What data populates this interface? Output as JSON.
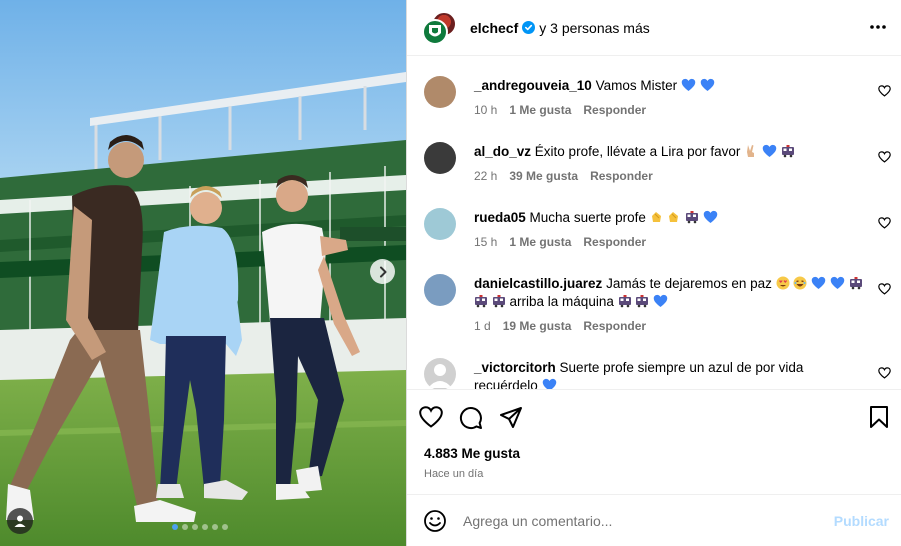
{
  "header": {
    "username": "elchecf",
    "collaborators_text": "y 3 personas más"
  },
  "comments": [
    {
      "username": "_andregouveia_10",
      "text": "Vamos Mister",
      "emojis": [
        "blue-heart",
        "blue-heart"
      ],
      "time": "10 h",
      "likes": "1 Me gusta",
      "reply": "Responder",
      "avatar_color": "#b08a6a"
    },
    {
      "username": "al_do_vz",
      "text": "Éxito profe, llévate a Lira por favor",
      "emojis": [
        "victory-hand",
        "blue-heart",
        "train"
      ],
      "time": "22 h",
      "likes": "39 Me gusta",
      "reply": "Responder",
      "avatar_color": "#3a3a3a"
    },
    {
      "username": "rueda05",
      "text": "Mucha suerte profe",
      "emojis": [
        "clap",
        "clap",
        "train",
        "blue-heart"
      ],
      "time": "15 h",
      "likes": "1 Me gusta",
      "reply": "Responder",
      "avatar_color": "#9ec9d6"
    },
    {
      "username": "danielcastillo.juarez",
      "text": "Jamás te dejaremos en paz",
      "emojis": [
        "heart-eyes",
        "laugh",
        "blue-heart",
        "blue-heart",
        "train"
      ],
      "text2": "arriba la máquina",
      "emojis_pre2": [
        "train",
        "train"
      ],
      "emojis2": [
        "train",
        "train",
        "blue-heart"
      ],
      "time": "1 d",
      "likes": "19 Me gusta",
      "reply": "Responder",
      "avatar_color": "#7a9cc0"
    },
    {
      "username": "_victorcitorh",
      "text": "Suerte profe siempre un azul de por vida",
      "text2": "recuérdelo",
      "emojis2": [
        "blue-heart"
      ],
      "avatar_color": "#d0d0d0"
    }
  ],
  "likes_count": "4.883 Me gusta",
  "post_time": "Hace un día",
  "add_comment": {
    "placeholder": "Agrega un comentario...",
    "publish_label": "Publicar"
  },
  "carousel": {
    "dot_count": 6,
    "active_dot": 0
  },
  "colors": {
    "blue_heart": "#3b82f6",
    "verified": "#0095f6",
    "publish_disabled": "#b3dbff",
    "carousel_active_dot": "#4da0f0"
  }
}
